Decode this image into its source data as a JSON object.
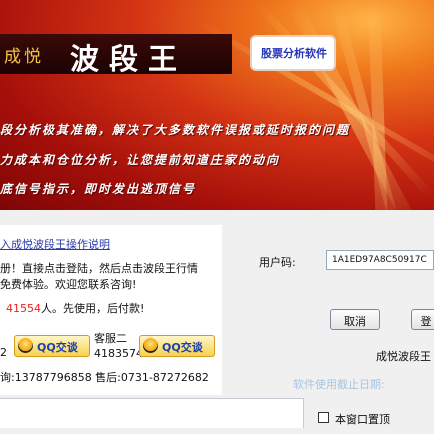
{
  "banner": {
    "brand": "成悦",
    "product": "波段王",
    "tag": "股票分析软件",
    "features": [
      "段分析极其准确，解决了大多数软件误报或延时报的问题",
      "力成本和仓位分析，让您提前知道庄家的动向",
      "底信号指示，即时发出逃顶信号"
    ]
  },
  "info": {
    "guide_link": "入成悦波段王操作说明",
    "line1": "册！直接点击登陆，然后点击波段王行情",
    "line2": "免费体验。欢迎您联系咨询!",
    "users_count": "41554",
    "users_suffix": "人。先使用，后付款!",
    "service1_number": "2",
    "service2_label": "客服二",
    "service2_number": "4183574",
    "qq_label": "QQ交谈",
    "phones": "询:13787796858 售后:0731-87272682"
  },
  "login": {
    "user_label": "用户码:",
    "user_value": "1A1ED97A8C50917C",
    "cancel_label": "取消",
    "login_label": "登",
    "app_name": "成悦波段王",
    "expiry_label": "软件使用截止日期:",
    "ontop_label": "本窗口置顶"
  }
}
